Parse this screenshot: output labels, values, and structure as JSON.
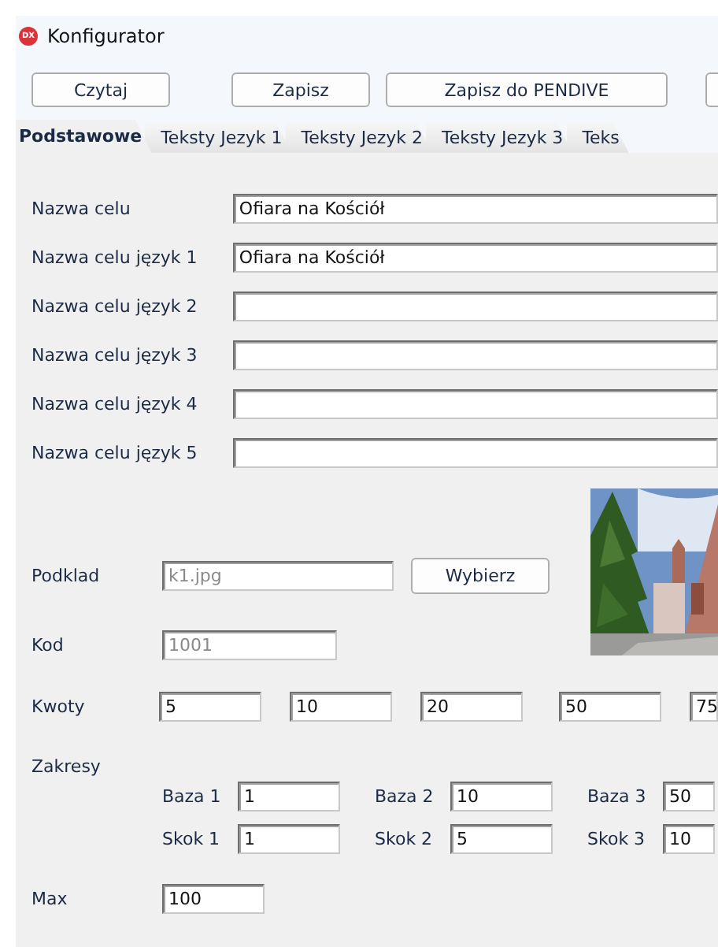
{
  "window": {
    "title": "Konfigurator",
    "logo": "DX"
  },
  "toolbar": {
    "buttons": [
      {
        "kind": "button",
        "label": "Czytaj"
      },
      {
        "kind": "button",
        "label": "Zapisz"
      },
      {
        "kind": "button",
        "label": "Zapisz do PENDIVE"
      },
      {
        "kind": "cut"
      }
    ]
  },
  "tabs": [
    {
      "label": "Podstawowe",
      "selected": true
    },
    {
      "label": "Teksty Jezyk 1",
      "selected": false
    },
    {
      "label": "Teksty Jezyk 2",
      "selected": false
    },
    {
      "label": "Teksty Jezyk 3",
      "selected": false
    },
    {
      "label": "Teks",
      "selected": false
    }
  ],
  "names": [
    {
      "label": "Nazwa celu",
      "value": "Ofiara na Kościół"
    },
    {
      "label": "Nazwa celu język 1",
      "value": "Ofiara na Kościół"
    },
    {
      "label": "Nazwa celu  język 2"
    },
    {
      "label": "Nazwa celu  język 3"
    },
    {
      "label": "Nazwa celu  język 4"
    },
    {
      "label": "Nazwa celu  język 5"
    }
  ],
  "background": {
    "label": "Podklad",
    "value": "k1.jpg",
    "disabled": true,
    "button": "Wybierz"
  },
  "code": {
    "label": "Kod",
    "value": "1001",
    "disabled": true
  },
  "amounts": {
    "label": "Kwoty",
    "values": [
      "5",
      "10",
      "20",
      "50",
      "75"
    ]
  },
  "ranges": {
    "label": "Zakresy",
    "rows": [
      [
        {
          "label": "Baza 1",
          "value": "1"
        },
        {
          "label": "Baza 2",
          "value": "10"
        },
        {
          "label": "Baza 3",
          "value": "50"
        }
      ],
      [
        {
          "label": "Skok 1",
          "value": "1"
        },
        {
          "label": "Skok 2",
          "value": "5"
        },
        {
          "label": "Skok 3",
          "value": "10"
        }
      ]
    ]
  },
  "max": {
    "label": "Max",
    "value": "100"
  }
}
